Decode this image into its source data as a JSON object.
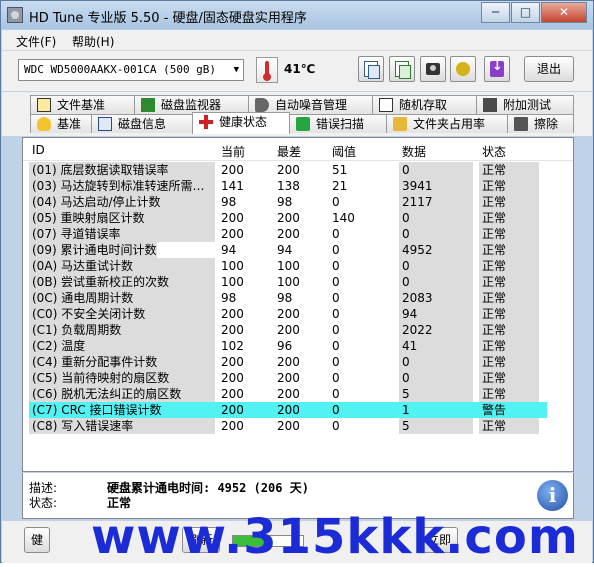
{
  "window": {
    "title": "HD Tune 专业版 5.50 - 硬盘/固态硬盘实用程序",
    "minimize": "─",
    "maximize": "□",
    "close": "✕"
  },
  "menu": {
    "file": "文件(F)",
    "help": "帮助(H)"
  },
  "toolbar": {
    "drive": "WDC WD5000AAKX-001CA (500 gB)",
    "temperature": "41℃",
    "exit": "退出"
  },
  "tabs_row1": [
    "文件基准",
    "磁盘监视器",
    "自动噪音管理",
    "随机存取",
    "附加测试"
  ],
  "tabs_row2": [
    "基准",
    "磁盘信息",
    "健康状态",
    "错误扫描",
    "文件夹占用率",
    "擦除"
  ],
  "active_tab": "健康状态",
  "table": {
    "headers": [
      "ID",
      "当前",
      "最差",
      "阈值",
      "数据",
      "状态"
    ],
    "rows": [
      [
        "(01) 底层数据读取错误率",
        "200",
        "200",
        "51",
        "0",
        "正常"
      ],
      [
        "(03) 马达旋转到标准转速所需…",
        "141",
        "138",
        "21",
        "3941",
        "正常"
      ],
      [
        "(04) 马达启动/停止计数",
        "98",
        "98",
        "0",
        "2117",
        "正常"
      ],
      [
        "(05) 重映射扇区计数",
        "200",
        "200",
        "140",
        "0",
        "正常"
      ],
      [
        "(07) 寻道错误率",
        "200",
        "200",
        "0",
        "0",
        "正常"
      ],
      [
        "(09) 累计通电时间计数",
        "94",
        "94",
        "0",
        "4952",
        "正常"
      ],
      [
        "(0A) 马达重试计数",
        "100",
        "100",
        "0",
        "0",
        "正常"
      ],
      [
        "(0B) 尝试重新校正的次数",
        "100",
        "100",
        "0",
        "0",
        "正常"
      ],
      [
        "(0C) 通电周期计数",
        "98",
        "98",
        "0",
        "2083",
        "正常"
      ],
      [
        "(C0) 不安全关闭计数",
        "200",
        "200",
        "0",
        "94",
        "正常"
      ],
      [
        "(C1) 负载周期数",
        "200",
        "200",
        "0",
        "2022",
        "正常"
      ],
      [
        "(C2) 温度",
        "102",
        "96",
        "0",
        "41",
        "正常"
      ],
      [
        "(C4) 重新分配事件计数",
        "200",
        "200",
        "0",
        "0",
        "正常"
      ],
      [
        "(C5) 当前待映射的扇区数",
        "200",
        "200",
        "0",
        "0",
        "正常"
      ],
      [
        "(C6) 脱机无法纠正的扇区数",
        "200",
        "200",
        "0",
        "5",
        "正常"
      ],
      [
        "(C7) CRC 接口错误计数",
        "200",
        "200",
        "0",
        "1",
        "警告"
      ],
      [
        "(C8) 写入错误速率",
        "200",
        "200",
        "0",
        "5",
        "正常"
      ]
    ]
  },
  "info": {
    "desc_label": "描述:",
    "desc_value": "硬盘累计通电时间: 4952 (206 天)",
    "status_label": "状态:",
    "status_value": "正常"
  },
  "bottom": {
    "left_button": "健",
    "refresh_button": "刷新",
    "right_button": "立即",
    "progress": 0.5
  },
  "watermark": "www.315kkk.com"
}
